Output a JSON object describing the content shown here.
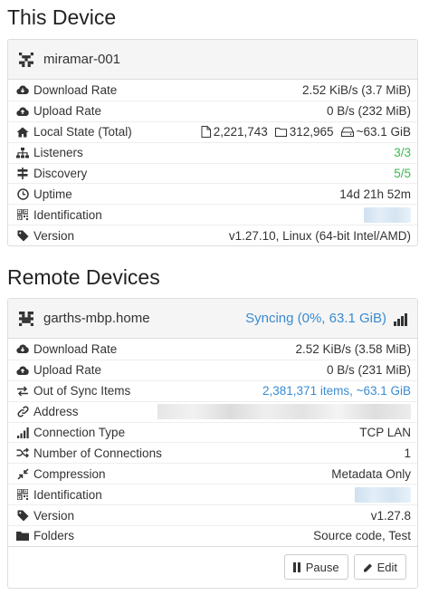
{
  "this_device": {
    "section_title": "This Device",
    "name": "miramar-001",
    "rows": {
      "download": {
        "label": "Download Rate",
        "value": "2.52 KiB/s (3.7 MiB)"
      },
      "upload": {
        "label": "Upload Rate",
        "value": "0 B/s (232 MiB)"
      },
      "local_state": {
        "label": "Local State (Total)",
        "files": "2,221,743",
        "dirs": "312,965",
        "size": "~63.1 GiB"
      },
      "listeners": {
        "label": "Listeners",
        "value": "3/3"
      },
      "discovery": {
        "label": "Discovery",
        "value": "5/5"
      },
      "uptime": {
        "label": "Uptime",
        "value": "14d 21h 52m"
      },
      "identification": {
        "label": "Identification"
      },
      "version": {
        "label": "Version",
        "value": "v1.27.10, Linux (64-bit Intel/AMD)"
      }
    }
  },
  "remote_devices": {
    "section_title": "Remote Devices",
    "device": {
      "name": "garths-mbp.home",
      "status": "Syncing (0%, 63.1 GiB)",
      "rows": {
        "download": {
          "label": "Download Rate",
          "value": "2.52 KiB/s (3.58 MiB)"
        },
        "upload": {
          "label": "Upload Rate",
          "value": "0 B/s (231 MiB)"
        },
        "out_of_sync": {
          "label": "Out of Sync Items",
          "value": "2,381,371 items, ~63.1 GiB"
        },
        "address": {
          "label": "Address"
        },
        "connection_type": {
          "label": "Connection Type",
          "value": "TCP LAN"
        },
        "num_connections": {
          "label": "Number of Connections",
          "value": "1"
        },
        "compression": {
          "label": "Compression",
          "value": "Metadata Only"
        },
        "identification": {
          "label": "Identification"
        },
        "version": {
          "label": "Version",
          "value": "v1.27.8"
        },
        "folders": {
          "label": "Folders",
          "value": "Source code, Test"
        }
      },
      "buttons": {
        "pause": "Pause",
        "edit": "Edit"
      }
    }
  },
  "colors": {
    "accent": "#3a8bd1",
    "ok": "#3cb84e",
    "panel_header": "#f5f5f5",
    "border": "#dddddd"
  }
}
